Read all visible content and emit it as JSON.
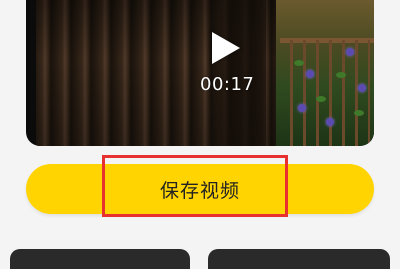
{
  "video": {
    "duration": "00:17",
    "play_icon": "play-icon"
  },
  "actions": {
    "save_label": "保存视频"
  },
  "colors": {
    "accent": "#ffd400",
    "highlight": "#e8312f",
    "page_bg": "#f4f4f4"
  }
}
